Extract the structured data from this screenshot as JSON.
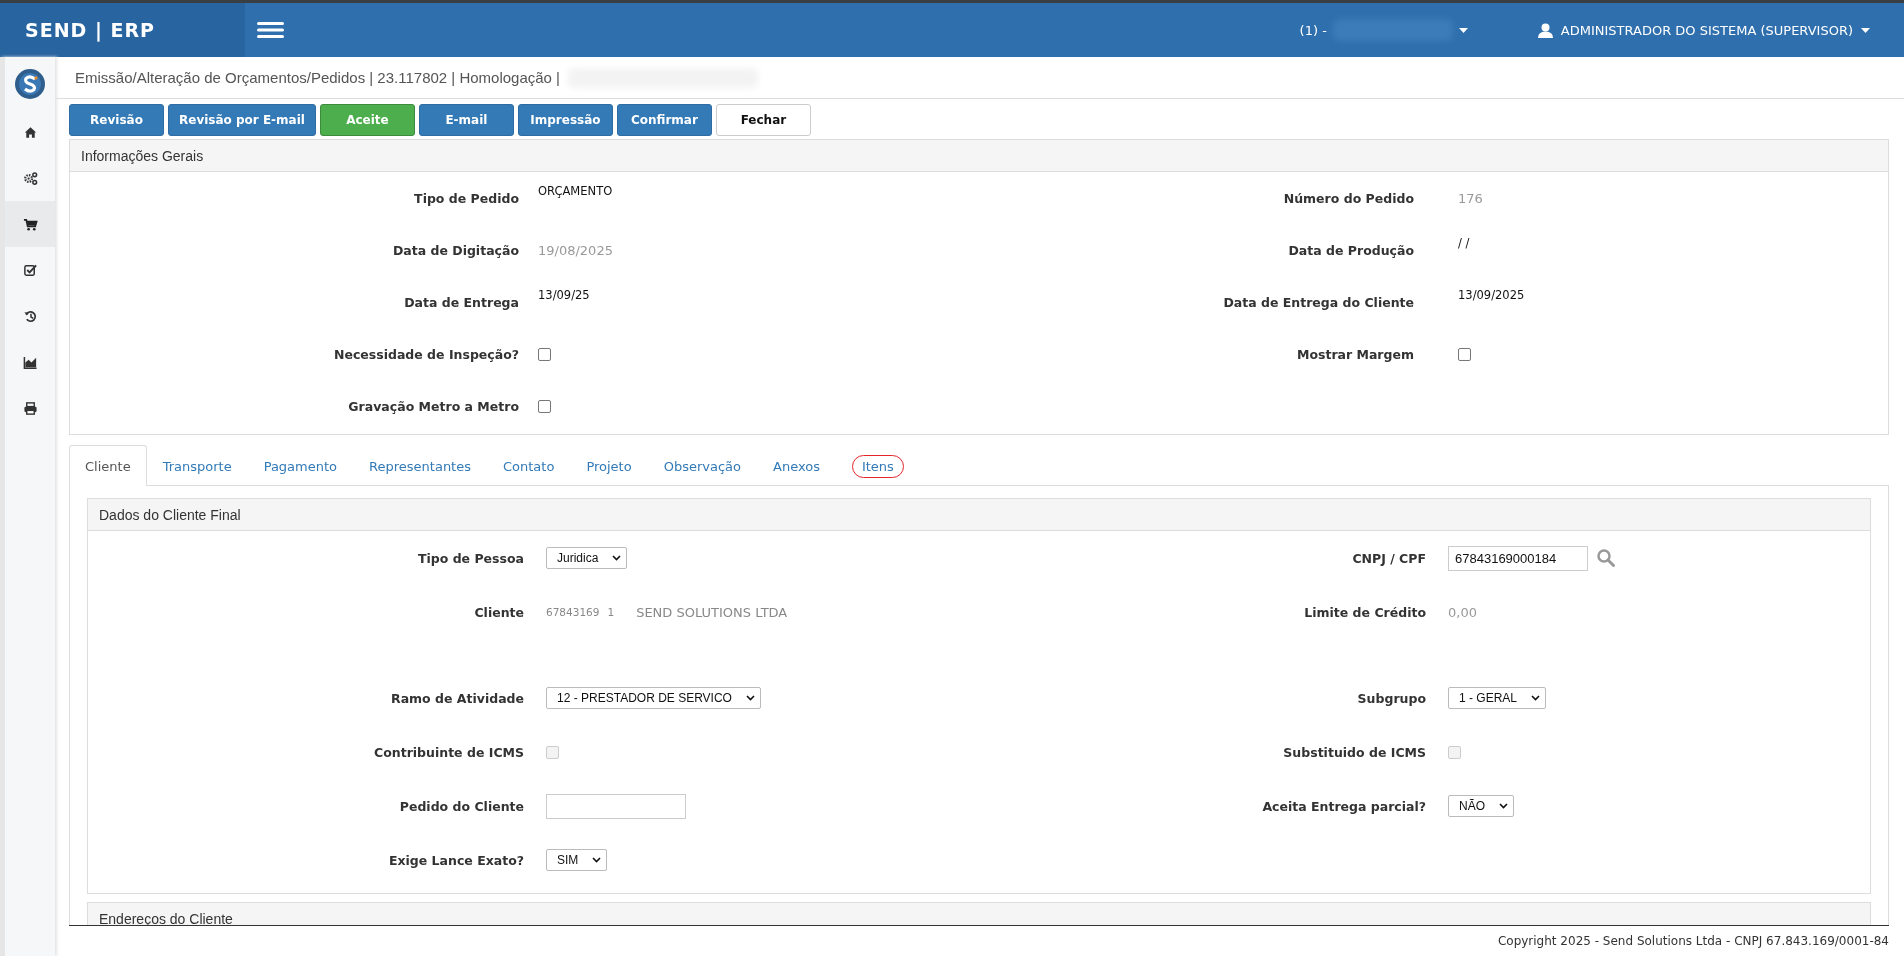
{
  "brand": "SEND | ERP",
  "topbar": {
    "company_prefix": "(1) -",
    "user": "ADMINISTRADOR DO SISTEMA (SUPERVISOR)"
  },
  "sidebar": {
    "items": [
      {
        "kind": "home",
        "selected": false
      },
      {
        "kind": "gears",
        "selected": false
      },
      {
        "kind": "cart",
        "selected": true
      },
      {
        "kind": "check",
        "selected": false
      },
      {
        "kind": "history",
        "selected": false
      },
      {
        "kind": "chart",
        "selected": false
      },
      {
        "kind": "print",
        "selected": false
      }
    ]
  },
  "page_title": "Emissão/Alteração de Orçamentos/Pedidos | 23.117802 | Homologação |",
  "actions": [
    {
      "label": "Revisão",
      "kind": "primary"
    },
    {
      "label": "Revisão por E-mail",
      "kind": "primary"
    },
    {
      "label": "Aceite",
      "kind": "success"
    },
    {
      "label": "E-mail",
      "kind": "primary"
    },
    {
      "label": "Impressão",
      "kind": "primary"
    },
    {
      "label": "Confirmar",
      "kind": "primary"
    },
    {
      "label": "Fechar",
      "kind": "default"
    }
  ],
  "general": {
    "title": "Informações Gerais",
    "rows": [
      {
        "left": {
          "label": "Tipo de Pedido",
          "kind": "text",
          "value": "ORÇAMENTO"
        },
        "right": {
          "label": "Número do Pedido",
          "kind": "readonly",
          "value": "176"
        }
      },
      {
        "left": {
          "label": "Data de Digitação",
          "kind": "readonly",
          "value": "19/08/2025"
        },
        "right": {
          "label": "Data de Produção",
          "kind": "text",
          "value": "/ /"
        }
      },
      {
        "left": {
          "label": "Data de Entrega",
          "kind": "text",
          "value": "13/09/25"
        },
        "right": {
          "label": "Data de Entrega do Cliente",
          "kind": "text",
          "value": "13/09/2025"
        }
      },
      {
        "left": {
          "label": "Necessidade de Inspeção?",
          "kind": "checkbox",
          "checked": false,
          "disabled": false
        },
        "right": {
          "label": "Mostrar Margem",
          "kind": "checkbox",
          "checked": false,
          "disabled": false
        }
      },
      {
        "left": {
          "label": "Gravação Metro a Metro",
          "kind": "checkbox",
          "checked": false,
          "disabled": false
        }
      }
    ]
  },
  "tabs": [
    {
      "label": "Cliente",
      "selected": true,
      "highlighted": false
    },
    {
      "label": "Transporte",
      "selected": false,
      "highlighted": false
    },
    {
      "label": "Pagamento",
      "selected": false,
      "highlighted": false
    },
    {
      "label": "Representantes",
      "selected": false,
      "highlighted": false
    },
    {
      "label": "Contato",
      "selected": false,
      "highlighted": false
    },
    {
      "label": "Projeto",
      "selected": false,
      "highlighted": false
    },
    {
      "label": "Observação",
      "selected": false,
      "highlighted": false
    },
    {
      "label": "Anexos",
      "selected": false,
      "highlighted": false
    },
    {
      "label": "Itens",
      "selected": false,
      "highlighted": true
    }
  ],
  "client_panel": {
    "title": "Dados do Cliente Final",
    "rows": [
      {
        "left": {
          "label": "Tipo de Pessoa",
          "kind": "select",
          "value": "Juridica"
        },
        "right": {
          "label": "CNPJ / CPF",
          "kind": "search-input",
          "value": "67843169000184"
        }
      },
      {
        "left": {
          "label": "Cliente",
          "kind": "client",
          "code": "67843169",
          "branch": "1",
          "name": "SEND SOLUTIONS LTDA"
        },
        "right": {
          "label": "Limite de Crédito",
          "kind": "readonly",
          "value": "0,00"
        }
      },
      {
        "left": {
          "label": "Ramo de Atividade",
          "kind": "select",
          "value": "12 - PRESTADOR DE SERVICO"
        },
        "right": {
          "label": "Subgrupo",
          "kind": "select",
          "value": "1 - GERAL"
        }
      },
      {
        "left": {
          "label": "Contribuinte de ICMS",
          "kind": "checkbox",
          "checked": false,
          "disabled": true
        },
        "right": {
          "label": "Substituido de ICMS",
          "kind": "checkbox",
          "checked": false,
          "disabled": true
        }
      },
      {
        "left": {
          "label": "Pedido do Cliente",
          "kind": "input"
        },
        "right": {
          "label": "Aceita Entrega parcial?",
          "kind": "select",
          "value": "NÃO"
        }
      },
      {
        "left": {
          "label": "Exige Lance Exato?",
          "kind": "select",
          "value": "SIM"
        }
      }
    ]
  },
  "address_panel": {
    "title": "Endereços do Cliente"
  },
  "footer": "Copyright 2025 - Send Solutions Ltda - CNPJ 67.843.169/0001-84"
}
